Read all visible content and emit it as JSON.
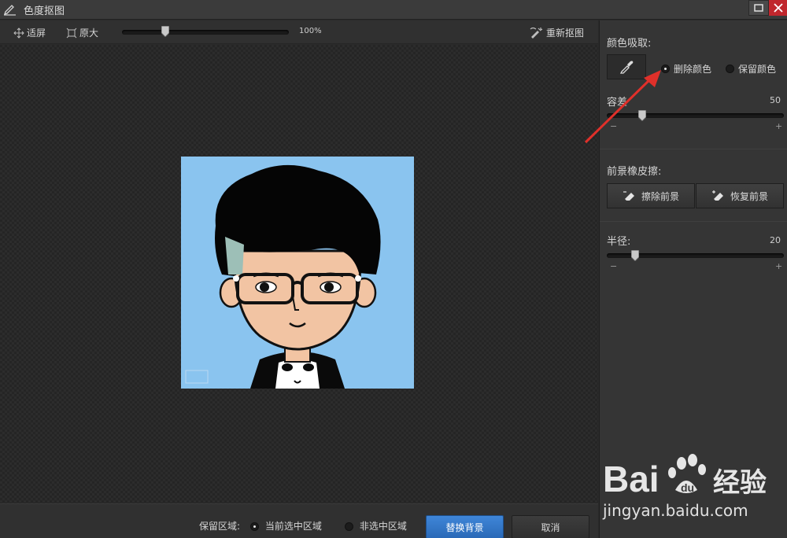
{
  "window": {
    "title": "色度抠图"
  },
  "toolbar": {
    "fit_label": "适屏",
    "original_label": "原大",
    "zoom_text": "100%",
    "zoom_level": 0.26,
    "redo_label": "重新抠图"
  },
  "bottom": {
    "keep_area_label": "保留区域:",
    "option_selected": "当前选中区域",
    "option_unselected": "非选中区域",
    "selected_option": "当前选中区域",
    "replace_bg_label": "替换背景",
    "cancel_label": "取消"
  },
  "panel": {
    "color_pick": {
      "label": "颜色吸取:",
      "delete_color_label": "删除颜色",
      "keep_color_label": "保留颜色",
      "selected": "删除颜色"
    },
    "tolerance": {
      "label": "容差",
      "value": "50",
      "level": 0.2,
      "minus": "−",
      "plus": "+"
    },
    "eraser": {
      "label": "前景橡皮擦:",
      "erase_label": "擦除前景",
      "restore_label": "恢复前景"
    },
    "radius": {
      "label": "半径:",
      "value": "20",
      "level": 0.16,
      "minus": "−",
      "plus": "+"
    }
  },
  "watermark": {
    "url": "jingyan.baidu.com"
  },
  "colors": {
    "accent_blue": "#2f72c4",
    "close_red": "#c0272d",
    "image_background": "#8ac4ef",
    "annotation_arrow": "#e0302a"
  },
  "icons": [
    "pen-icon",
    "restore-icon",
    "close-icon",
    "fit-screen-icon",
    "original-size-icon",
    "slider-thumb-icon",
    "redo-cutout-icon",
    "eyedropper-icon",
    "eraser-icon",
    "restore-eraser-icon"
  ]
}
